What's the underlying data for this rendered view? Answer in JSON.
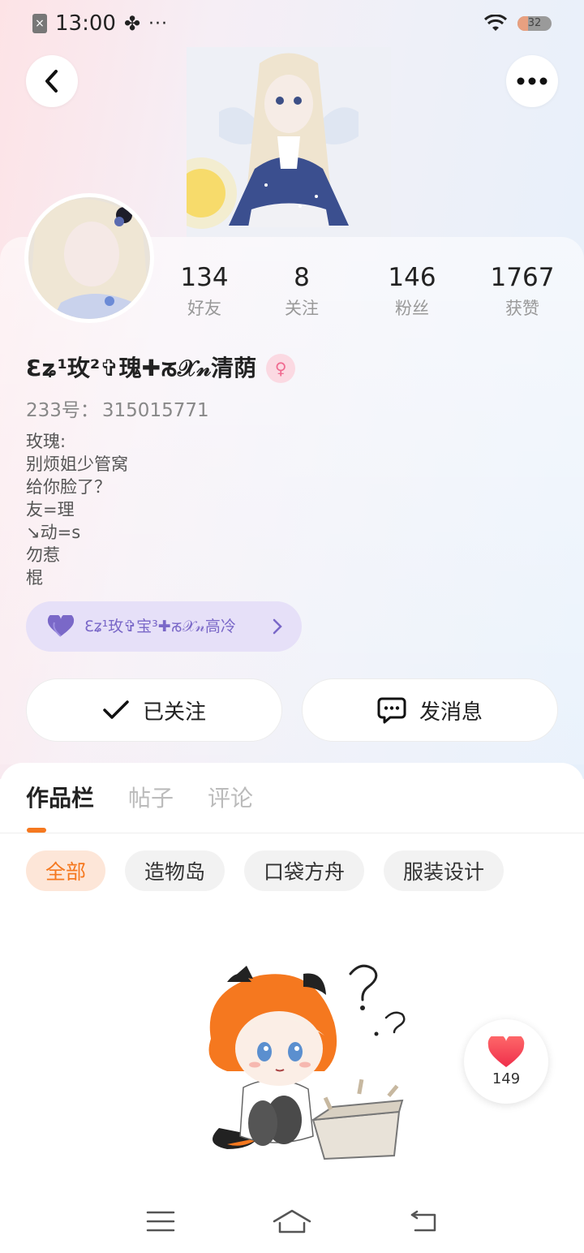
{
  "status_bar": {
    "time": "13:00",
    "more": "···",
    "battery_level": "32"
  },
  "profile": {
    "nickname": "Ɛʑ¹玫²✞瑰✚ᰕ𝒳𝓃清荫",
    "gender_icon": "female-icon",
    "uid_label": "233号：",
    "uid_value": "315015771",
    "bio_lines": [
      "玫瑰:",
      "别烦姐少管窝",
      "给你脸了？",
      "友=理",
      "↘动=s",
      "勿惹",
      "棍"
    ]
  },
  "stats": [
    {
      "value": "134",
      "label": "好友"
    },
    {
      "value": "8",
      "label": "关注"
    },
    {
      "value": "146",
      "label": "粉丝"
    },
    {
      "value": "1767",
      "label": "获赞"
    }
  ],
  "cp_pill": {
    "text": "Ɛʑ¹玫✞宝³✚ᰕ𝒳𝓃高冷",
    "icon": "heart-icon"
  },
  "actions": {
    "follow_label": "已关注",
    "message_label": "发消息"
  },
  "tabs": [
    "作品栏",
    "帖子",
    "评论"
  ],
  "chips": [
    "全部",
    "造物岛",
    "口袋方舟",
    "服装设计"
  ],
  "like_float": {
    "count": "149"
  },
  "colors": {
    "accent": "#f5781f",
    "purple": "#7a68c8",
    "pink": "#f06a90"
  }
}
